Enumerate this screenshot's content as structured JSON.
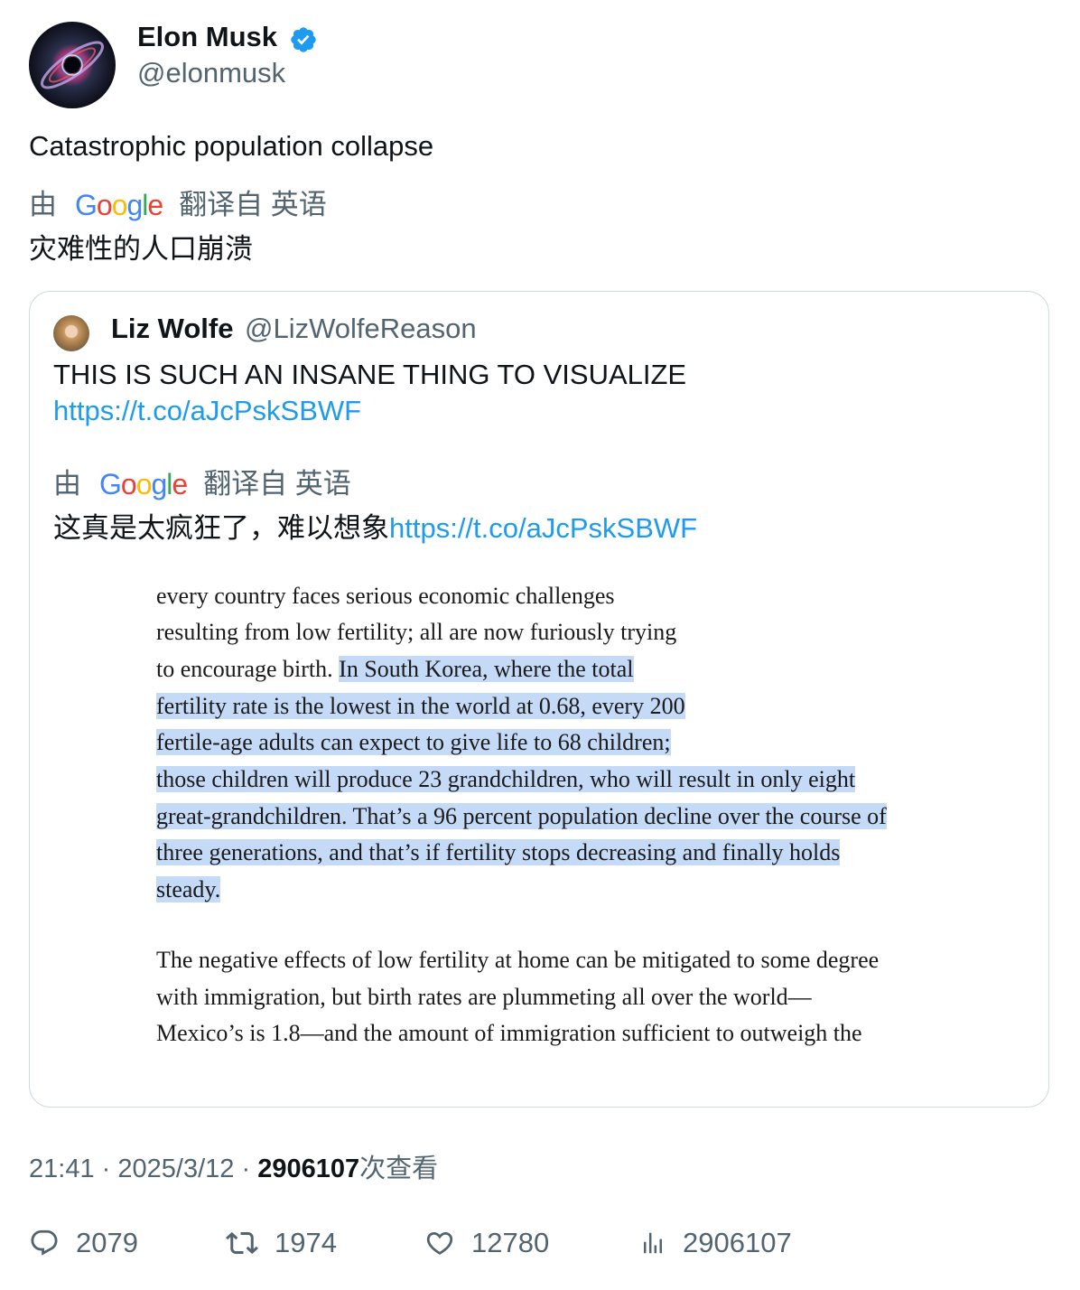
{
  "author": {
    "name": "Elon Musk",
    "handle": "@elonmusk"
  },
  "tweet": {
    "text": "Catastrophic population collapse",
    "translation_by": "由",
    "translation_from": "翻译自 英语",
    "translated_text": "灾难性的人口崩溃"
  },
  "quoted": {
    "name": "Liz Wolfe",
    "handle": "@LizWolfeReason",
    "text": "THIS IS SUCH AN INSANE THING TO VISUALIZE",
    "link": "https://t.co/aJcPskSBWF",
    "translation_by": "由",
    "translation_from": "翻译自 英语",
    "translated_text": "这真是太疯狂了，难以想象",
    "translated_link": "https://t.co/aJcPskSBWF",
    "image_lines": {
      "l1": "every country faces serious economic challenges",
      "l2": "resulting from low fertility; all are now furiously trying",
      "l3a": "to encourage birth. ",
      "l3b": "In South Korea, where the total",
      "l4": "fertility rate is the lowest in the world at 0.68, every 200",
      "l5": "fertile-age adults can expect to give life to 68 children;",
      "l6": "those children will produce 23 grandchildren, who will result in only eight",
      "l7": "great-grandchildren. That’s a 96 percent population decline over the course of",
      "l8": "three generations, and that’s if fertility stops decreasing and finally holds",
      "l9": "steady.",
      "l10": "The negative effects of low fertility at home can be mitigated to some degree",
      "l11": "with immigration, but birth rates are plummeting all over the world—",
      "l12": "Mexico’s is 1.8—and the amount of immigration sufficient to outweigh the"
    }
  },
  "meta": {
    "time": "21:41",
    "sep": "·",
    "date": "2025/3/12",
    "views": "2906107",
    "views_label": "次查看"
  },
  "stats": {
    "replies": "2079",
    "retweets": "1974",
    "likes": "12780",
    "views": "2906107"
  },
  "colors": {
    "link": "#1d9bf0",
    "muted": "#536471",
    "highlight": "#c5daf7",
    "verified": "#1d9bf0"
  }
}
